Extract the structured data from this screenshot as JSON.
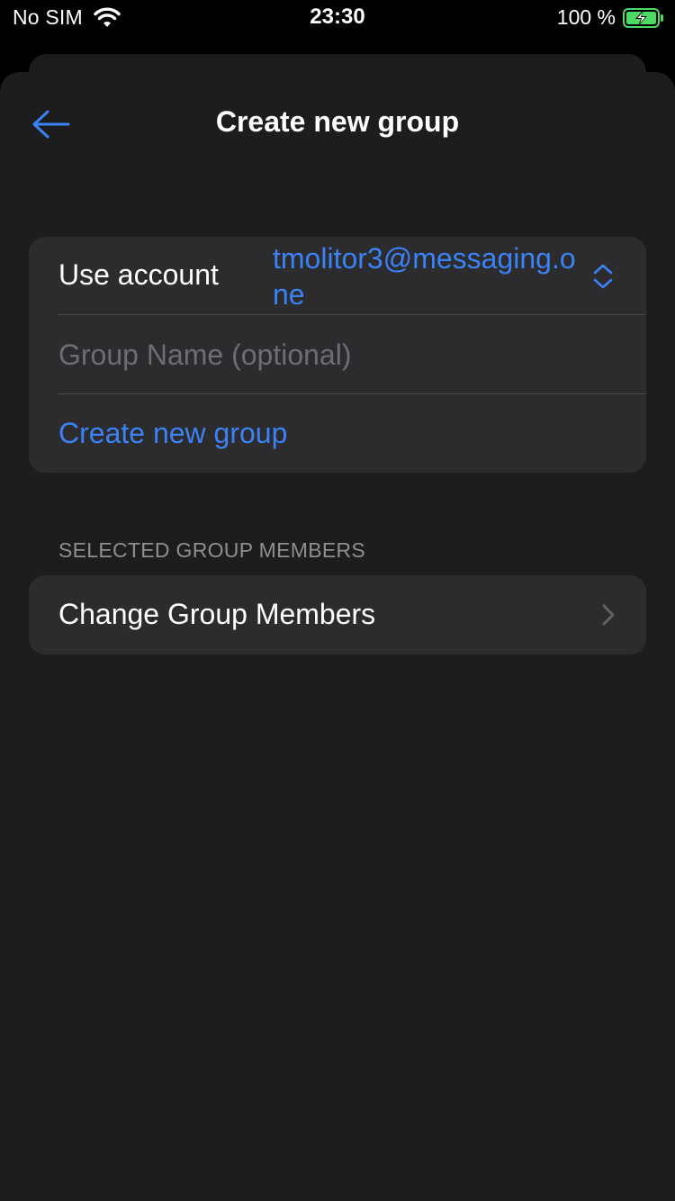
{
  "status_bar": {
    "carrier": "No SIM",
    "time": "23:30",
    "battery": "100 %",
    "wifi_icon": "wifi-icon",
    "battery_icon": "battery-charging-icon"
  },
  "nav": {
    "title": "Create new group",
    "back_icon": "arrow-left-icon"
  },
  "form": {
    "account_label": "Use account",
    "account_value": "tmolitor3@messaging.one",
    "account_icon": "chevron-up-down-icon",
    "group_name_value": "",
    "group_name_placeholder": "Group Name (optional)",
    "create_label": "Create new group"
  },
  "members": {
    "section_header": "SELECTED GROUP MEMBERS",
    "change_label": "Change Group Members",
    "chevron_icon": "chevron-right-icon"
  },
  "colors": {
    "accent": "#3b82f6",
    "background": "#1d1d1e",
    "card": "#2c2c2e",
    "battery_fill": "#4cd964"
  }
}
